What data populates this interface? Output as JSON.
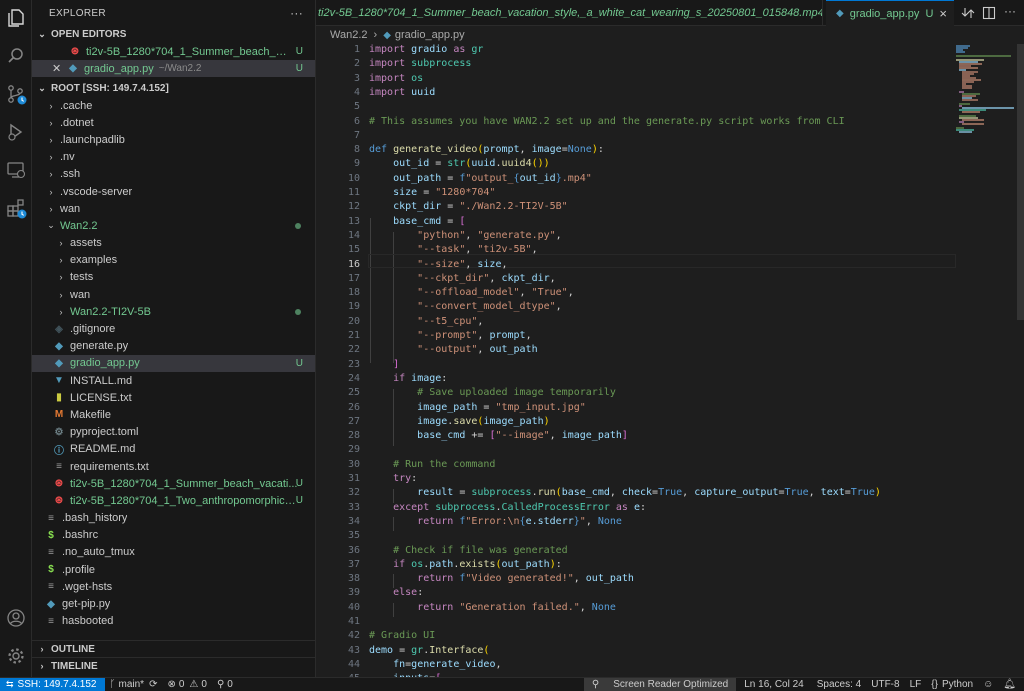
{
  "explorer": {
    "title": "EXPLORER",
    "more": "···",
    "open_editors": {
      "label": "OPEN EDITORS",
      "items": [
        {
          "name": "ti2v-5B_1280*704_1_Summer_beach_vaca...",
          "status": "U"
        },
        {
          "name": "gradio_app.py",
          "path": "~/Wan2.2",
          "status": "U"
        }
      ]
    },
    "root": {
      "label": "ROOT [SSH: 149.7.4.152]",
      "items": [
        {
          "name": ".cache"
        },
        {
          "name": ".dotnet"
        },
        {
          "name": ".launchpadlib"
        },
        {
          "name": ".nv"
        },
        {
          "name": ".ssh"
        },
        {
          "name": ".vscode-server"
        },
        {
          "name": "wan"
        },
        {
          "name": "Wan2.2"
        },
        {
          "name": "assets"
        },
        {
          "name": "examples"
        },
        {
          "name": "tests"
        },
        {
          "name": "wan"
        },
        {
          "name": "Wan2.2-TI2V-5B"
        },
        {
          "name": ".gitignore"
        },
        {
          "name": "generate.py"
        },
        {
          "name": "gradio_app.py",
          "status": "U"
        },
        {
          "name": "INSTALL.md"
        },
        {
          "name": "LICENSE.txt"
        },
        {
          "name": "Makefile"
        },
        {
          "name": "pyproject.toml"
        },
        {
          "name": "README.md"
        },
        {
          "name": "requirements.txt"
        },
        {
          "name": "ti2v-5B_1280*704_1_Summer_beach_vacati...",
          "status": "U"
        },
        {
          "name": "ti2v-5B_1280*704_1_Two_anthropomorphic_...",
          "status": "U"
        },
        {
          "name": ".bash_history"
        },
        {
          "name": ".bashrc"
        },
        {
          "name": ".no_auto_tmux"
        },
        {
          "name": ".profile"
        },
        {
          "name": ".wget-hsts"
        },
        {
          "name": "get-pip.py"
        },
        {
          "name": "hasbooted"
        }
      ]
    },
    "outline": "OUTLINE",
    "timeline": "TIMELINE"
  },
  "tabs": [
    {
      "name": "ti2v-5B_1280*704_1_Summer_beach_vacation_style,_a_white_cat_wearing_s_20250801_015848.mp4",
      "status": "U"
    },
    {
      "name": "gradio_app.py",
      "status": "U",
      "close": "×"
    }
  ],
  "breadcrumb": {
    "folder": "Wan2.2",
    "sep": "›",
    "file": "gradio_app.py"
  },
  "editor": {
    "line_numbers": [
      "1",
      "2",
      "3",
      "4",
      "5",
      "6",
      "7",
      "8",
      "9",
      "10",
      "11",
      "12",
      "13",
      "14",
      "15",
      "16",
      "17",
      "18",
      "19",
      "20",
      "21",
      "22",
      "23",
      "24",
      "25",
      "26",
      "27",
      "28",
      "29",
      "30",
      "31",
      "32",
      "33",
      "34",
      "35",
      "36",
      "37",
      "38",
      "39",
      "40",
      "41",
      "42",
      "43",
      "44",
      "45"
    ],
    "current_line": 16,
    "lines": [
      "import gradio as gr",
      "import subprocess",
      "import os",
      "import uuid",
      "",
      "# This assumes you have WAN2.2 set up and the generate.py script works from CLI",
      "",
      "def generate_video(prompt, image=None):",
      "    out_id = str(uuid.uuid4())",
      "    out_path = f\"output_{out_id}.mp4\"",
      "    size = \"1280*704\"",
      "    ckpt_dir = \"./Wan2.2-TI2V-5B\"",
      "    base_cmd = [",
      "        \"python\", \"generate.py\",",
      "        \"--task\", \"ti2v-5B\",",
      "        \"--size\", size,",
      "        \"--ckpt_dir\", ckpt_dir,",
      "        \"--offload_model\", \"True\",",
      "        \"--convert_model_dtype\",",
      "        \"--t5_cpu\",",
      "        \"--prompt\", prompt,",
      "        \"--output\", out_path",
      "    ]",
      "    if image:",
      "        # Save uploaded image temporarily",
      "        image_path = \"tmp_input.jpg\"",
      "        image.save(image_path)",
      "        base_cmd += [\"--image\", image_path]",
      "",
      "    # Run the command",
      "    try:",
      "        result = subprocess.run(base_cmd, check=True, capture_output=True, text=True)",
      "    except subprocess.CalledProcessError as e:",
      "        return f\"Error:\\n{e.stderr}\", None",
      "",
      "    # Check if file was generated",
      "    if os.path.exists(out_path):",
      "        return f\"Video generated!\", out_path",
      "    else:",
      "        return \"Generation failed.\", None",
      "",
      "# Gradio UI",
      "demo = gr.Interface(",
      "    fn=generate_video,",
      "    inputs=["
    ]
  },
  "statusbar": {
    "remote": "SSH: 149.7.4.152",
    "branch": "main*",
    "errors": "0",
    "warnings": "0",
    "ports": "0",
    "screen_reader": "Screen Reader Optimized",
    "position": "Ln 16, Col 24",
    "spaces": "Spaces: 4",
    "encoding": "UTF-8",
    "eol": "LF",
    "language": "Python"
  },
  "colors": {
    "accent": "#007acc",
    "untracked": "#73c991",
    "background": "#1e1e1e",
    "sidebar": "#181818"
  }
}
